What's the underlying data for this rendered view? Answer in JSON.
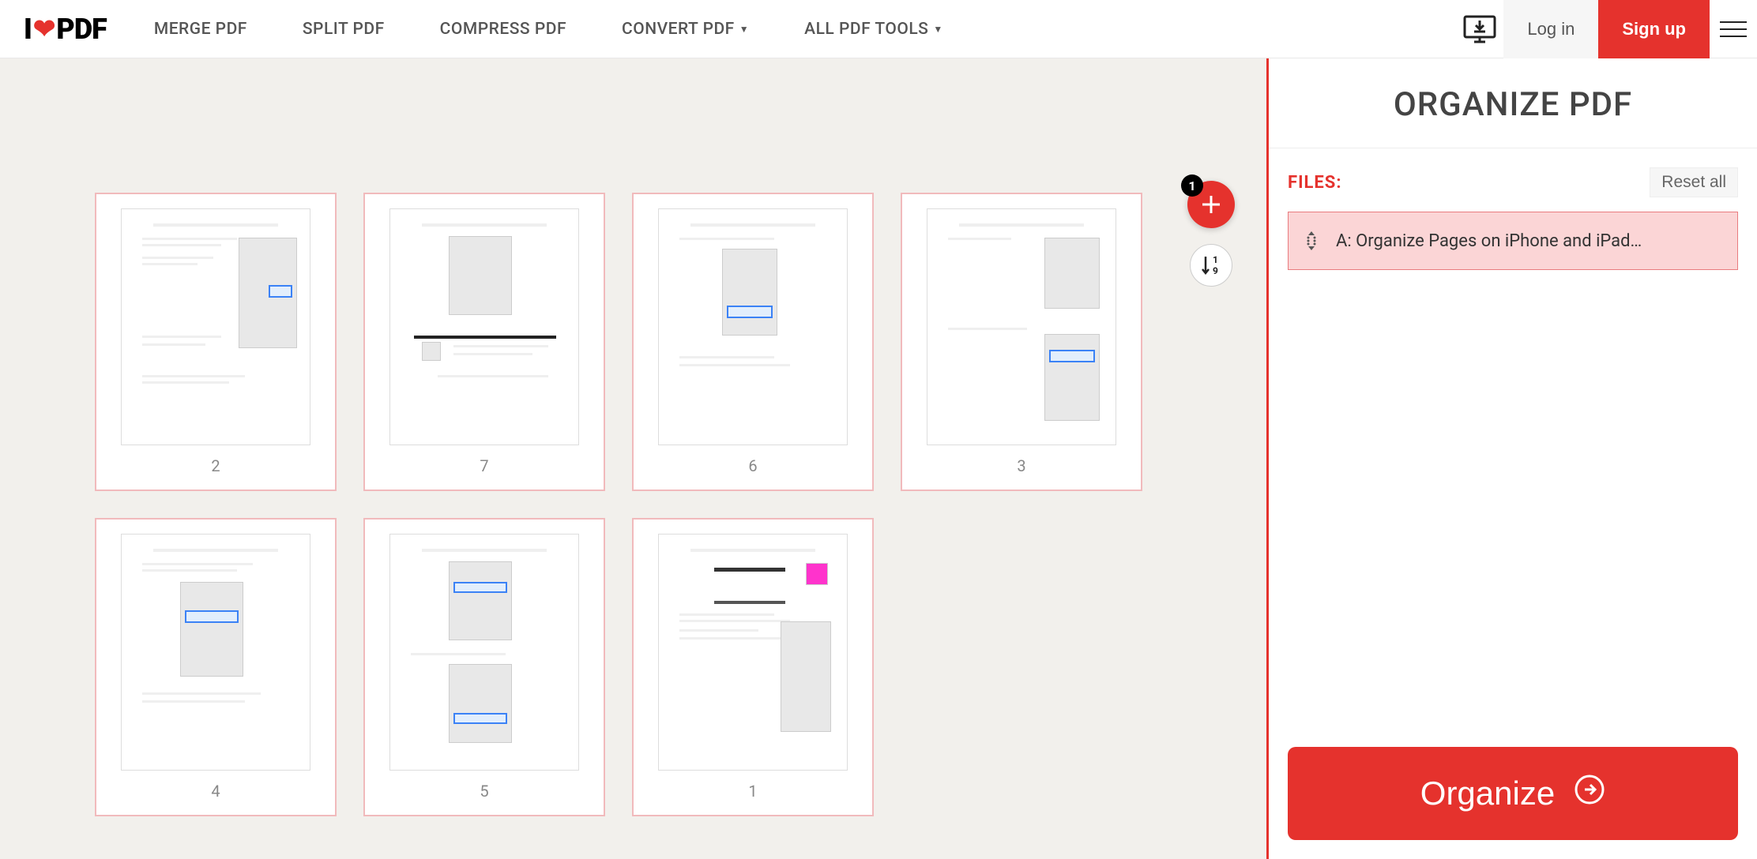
{
  "logo": {
    "before": "I",
    "after": "PDF"
  },
  "nav": {
    "merge": "MERGE PDF",
    "split": "SPLIT PDF",
    "compress": "COMPRESS PDF",
    "convert": "CONVERT PDF",
    "all": "ALL PDF TOOLS"
  },
  "header": {
    "login": "Log in",
    "signup": "Sign up"
  },
  "floating": {
    "badge": "1"
  },
  "sidebar": {
    "title": "ORGANIZE PDF",
    "files_label": "FILES:",
    "reset": "Reset all",
    "file_name": "A: Organize Pages on iPhone and iPad…",
    "organize": "Organize"
  },
  "pages": [
    {
      "num": "2"
    },
    {
      "num": "7"
    },
    {
      "num": "6"
    },
    {
      "num": "3"
    },
    {
      "num": "4"
    },
    {
      "num": "5"
    },
    {
      "num": "1"
    }
  ]
}
